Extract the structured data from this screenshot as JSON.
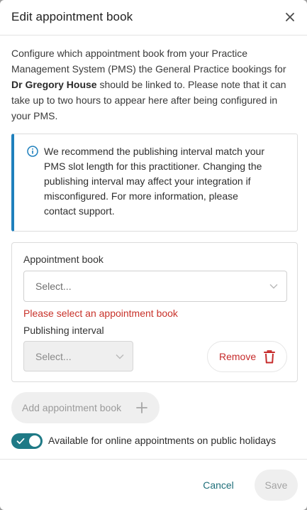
{
  "modal": {
    "title": "Edit appointment book",
    "close_icon": "close-icon"
  },
  "intro": {
    "text_before": "Configure which appointment book from your Practice Management System (PMS) the General Practice bookings for ",
    "practitioner_name": "Dr Gregory House",
    "text_after": " should be linked to. Please note that it can take up to two hours to appear here after being configured in your PMS."
  },
  "info": {
    "icon": "info-icon",
    "accent_color": "#1f80bd",
    "text": "We recommend the publishing interval match your PMS slot length for this practitioner. Changing the publishing interval may affect your integration if misconfigured. For more information, please contact support."
  },
  "appointment_book": {
    "label": "Appointment book",
    "value": "Select...",
    "error": "Please select an appointment book",
    "error_color": "#c8322a"
  },
  "publishing_interval": {
    "label": "Publishing interval",
    "value": "Select...",
    "disabled": true
  },
  "remove_button": {
    "label": "Remove",
    "icon": "trash-icon"
  },
  "add_button": {
    "label": "Add appointment book",
    "icon": "plus-icon",
    "disabled": true
  },
  "holiday_toggle": {
    "label": "Available for online appointments on public holidays",
    "on": true,
    "color": "#1f7a86"
  },
  "footer": {
    "cancel_label": "Cancel",
    "save_label": "Save",
    "save_disabled": true
  }
}
